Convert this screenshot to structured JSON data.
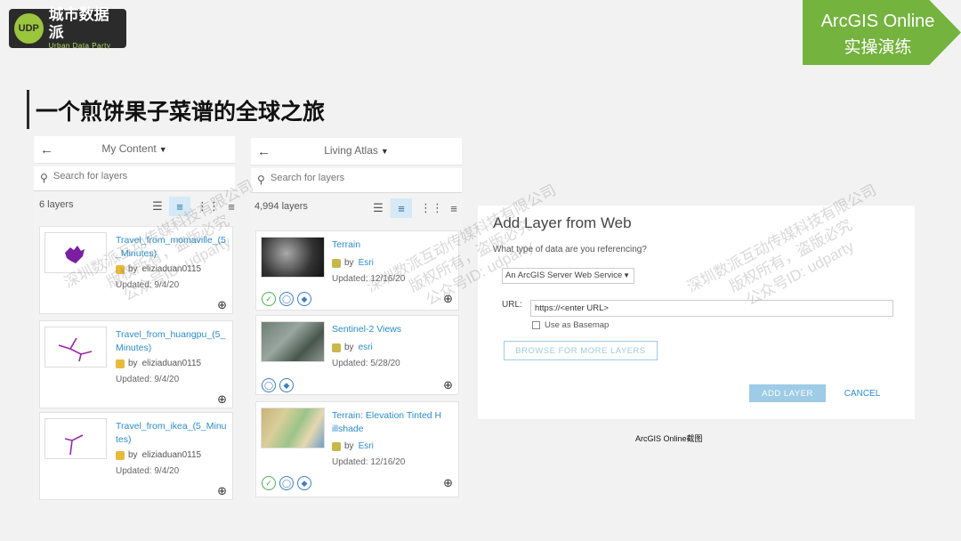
{
  "logo": {
    "mark": "UDP",
    "name_cn": "城市数据派",
    "name_en": "Urban Data Party"
  },
  "banner": {
    "line1": "ArcGIS Online",
    "line2": "实操演练"
  },
  "title": "一个煎饼果子菜谱的全球之旅",
  "panels": {
    "my_content": {
      "title": "My Content",
      "search_placeholder": "Search for layers",
      "count": "6 layers",
      "cards": [
        {
          "title": "Travel_from_momaville_(5_Minutes)",
          "by": "by",
          "owner": "eliziaduan0115",
          "updated": "Updated: 9/4/20"
        },
        {
          "title": "Travel_from_huangpu_(5_Minutes)",
          "by": "by",
          "owner": "eliziaduan0115",
          "updated": "Updated: 9/4/20"
        },
        {
          "title": "Travel_from_ikea_(5_Minutes)",
          "by": "by",
          "owner": "eliziaduan0115",
          "updated": "Updated: 9/4/20"
        }
      ]
    },
    "living_atlas": {
      "title": "Living Atlas",
      "search_placeholder": "Search for layers",
      "count": "4,994 layers",
      "cards": [
        {
          "title": "Terrain",
          "by": "by",
          "owner": "Esri",
          "updated": "Updated: 12/16/20"
        },
        {
          "title": "Sentinel-2 Views",
          "by": "by",
          "owner": "esri",
          "updated": "Updated: 5/28/20"
        },
        {
          "title": "Terrain: Elevation Tinted Hillshade",
          "by": "by",
          "owner": "Esri",
          "updated": "Updated: 12/16/20"
        }
      ]
    }
  },
  "dialog": {
    "title": "Add Layer from Web",
    "question": "What type of data are you referencing?",
    "select_value": "An ArcGIS Server Web Service",
    "url_label": "URL:",
    "url_value": "https://<enter URL>",
    "basemap_label": "Use as Basemap",
    "browse_label": "BROWSE FOR MORE LAYERS",
    "add_label": "ADD LAYER",
    "cancel_label": "CANCEL"
  },
  "caption": "ArcGIS Online截图",
  "watermark": {
    "line1": "深圳数派互动传媒科技有限公司",
    "line2": "版权所有，盗版必究",
    "line3": "公众号ID: udparty"
  },
  "colors": {
    "accent_green": "#74b33e",
    "link_blue": "#2c8ccf",
    "button_blue": "#9ecbe6"
  }
}
